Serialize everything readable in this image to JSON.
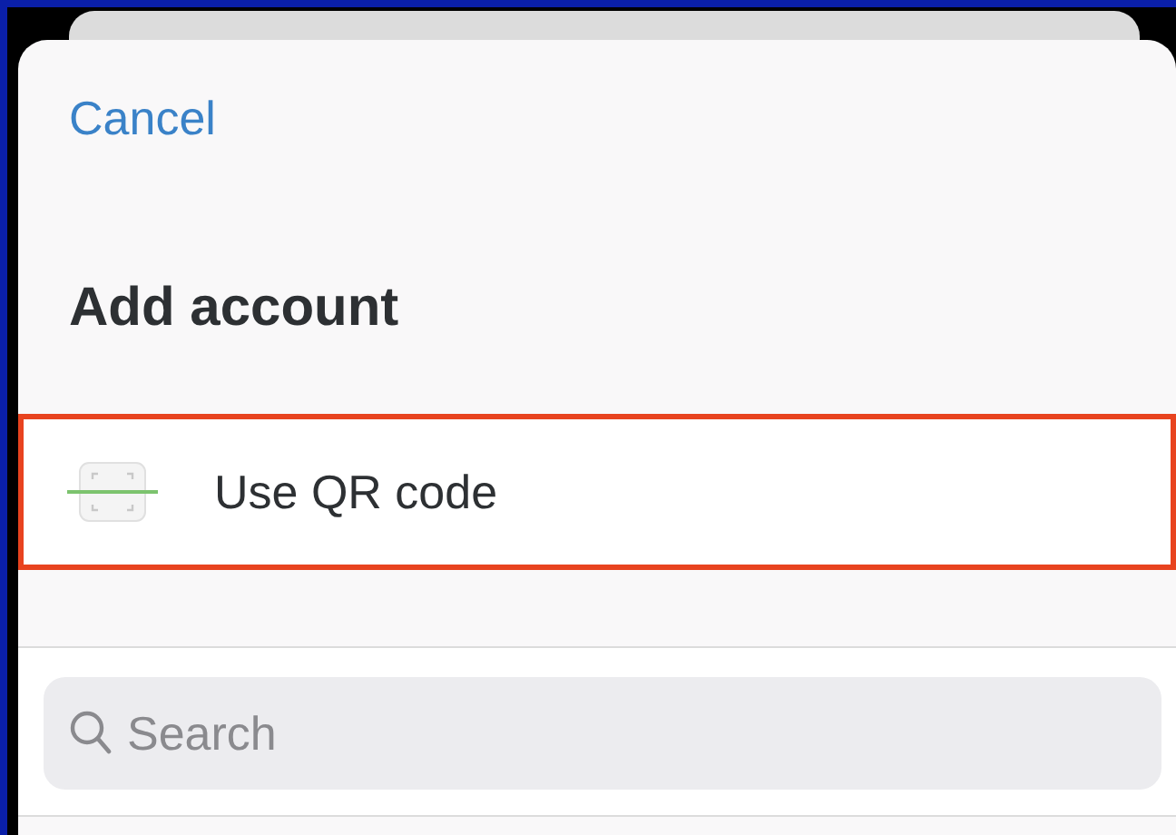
{
  "cancel": "Cancel",
  "title": "Add account",
  "options": [
    {
      "kind": "qr",
      "label": "Use QR code",
      "highlighted": true
    }
  ],
  "search": {
    "placeholder": "Search"
  }
}
